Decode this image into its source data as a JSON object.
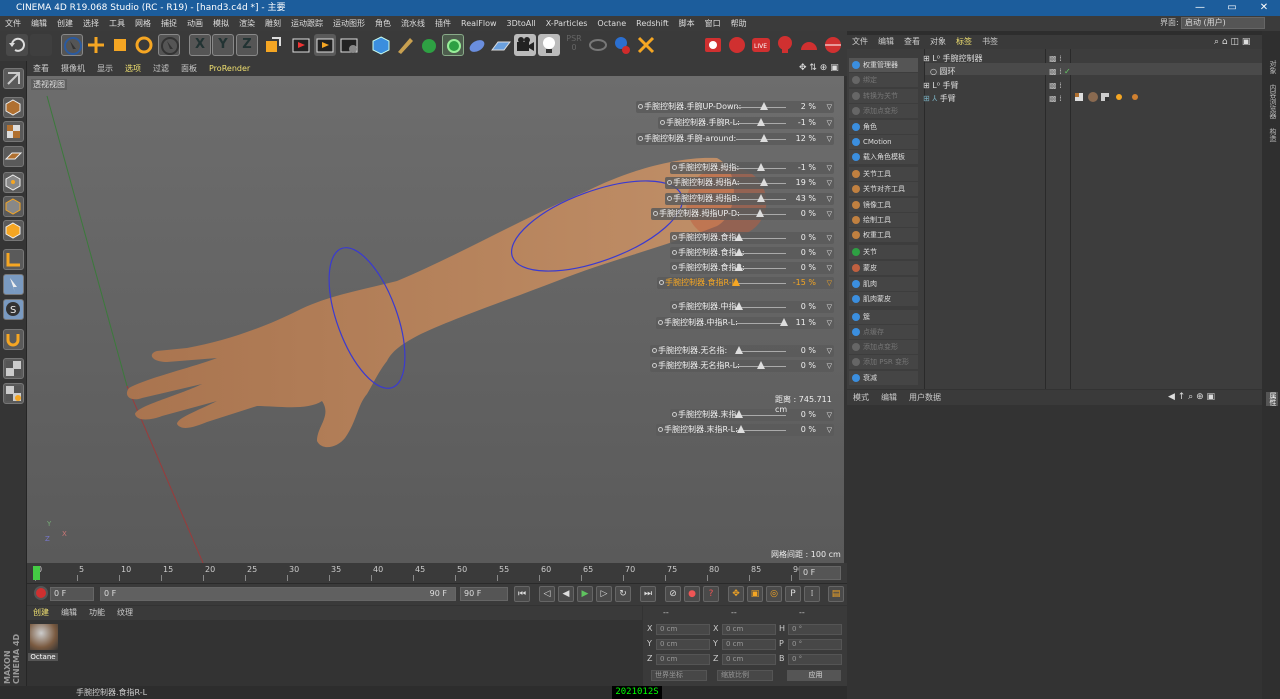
{
  "title": "CINEMA 4D R19.068 Studio (RC - R19) - [hand3.c4d *] - 主要",
  "menu": [
    "文件",
    "编辑",
    "创建",
    "选择",
    "工具",
    "网格",
    "捕捉",
    "动画",
    "模拟",
    "渲染",
    "雕刻",
    "运动跟踪",
    "运动图形",
    "角色",
    "流水线",
    "插件",
    "RealFlow",
    "3DtoAll",
    "X-Particles",
    "Octane",
    "Redshift",
    "脚本",
    "窗口",
    "帮助"
  ],
  "layout_label": "界面:",
  "layout_value": "启动 (用户)",
  "viewport": {
    "menu": [
      "查看",
      "摄像机",
      "显示",
      "选项",
      "过滤",
      "面板",
      "ProRender"
    ],
    "label": "透视视图",
    "distance": "距离 : 745.711 cm",
    "grid": "网格间距 : 100 cm"
  },
  "sliders": [
    {
      "label": "手腕控制器.手腕UP-Down:",
      "value": "2 %",
      "pos": 0.55
    },
    {
      "label": "手腕控制器.手腕R-L:",
      "value": "-1 %",
      "pos": 0.5
    },
    {
      "label": "手腕控制器.手腕-around:",
      "value": "12 %",
      "pos": 0.55
    },
    {
      "label": "手腕控制器.拇指:",
      "value": "-1 %",
      "pos": 0.5
    },
    {
      "label": "手腕控制器.拇指A:",
      "value": "19 %",
      "pos": 0.55
    },
    {
      "label": "手腕控制器.拇指B:",
      "value": "43 %",
      "pos": 0.5
    },
    {
      "label": "手腕控制器.拇指UP-D:",
      "value": "0 %",
      "pos": 0.48
    },
    {
      "label": "手腕控制器.食指:",
      "value": "0 %",
      "pos": 0.05
    },
    {
      "label": "手腕控制器.食指A:",
      "value": "0 %",
      "pos": 0.05
    },
    {
      "label": "手腕控制器.食指B:",
      "value": "0 %",
      "pos": 0.05
    },
    {
      "label": "手腕控制器.食指R-L:",
      "value": "-15 %",
      "pos": 0.0
    },
    {
      "label": "手腕控制器.中指:",
      "value": "0 %",
      "pos": 0.05
    },
    {
      "label": "手腕控制器.中指R-L:",
      "value": "11 %",
      "pos": 0.95
    },
    {
      "label": "手腕控制器.无名指:",
      "value": "0 %",
      "pos": 0.05
    },
    {
      "label": "手腕控制器.无名指R-L:",
      "value": "0 %",
      "pos": 0.5
    },
    {
      "label": "手腕控制器.末指:",
      "value": "0 %",
      "pos": 0.05
    },
    {
      "label": "手腕控制器.末指R-L:",
      "value": "0 %",
      "pos": 0.1
    }
  ],
  "timeline": {
    "ticks": [
      "0",
      "5",
      "10",
      "15",
      "20",
      "25",
      "30",
      "35",
      "40",
      "45",
      "50",
      "55",
      "60",
      "65",
      "70",
      "75",
      "80",
      "85",
      "90"
    ],
    "current": "0 F"
  },
  "transport": {
    "start": "0 F",
    "slider_left": "0 F",
    "slider_right": "90 F",
    "end": "90 F"
  },
  "material": {
    "menu": [
      "创建",
      "编辑",
      "功能",
      "纹理"
    ],
    "name": "Octane"
  },
  "coords": {
    "header": [
      "--",
      "--",
      "--"
    ],
    "rows": [
      [
        "X",
        "0 cm",
        "X",
        "0 cm",
        "H",
        "0 °"
      ],
      [
        "Y",
        "0 cm",
        "Y",
        "0 cm",
        "P",
        "0 °"
      ],
      [
        "Z",
        "0 cm",
        "Z",
        "0 cm",
        "B",
        "0 °"
      ]
    ],
    "mode1": "世界坐标",
    "mode2": "缩放比例",
    "apply": "应用"
  },
  "status": "手腕控制器.食指R-L",
  "watermark": "2021012S",
  "objects": {
    "menu": [
      "文件",
      "编辑",
      "查看",
      "对象",
      "标签",
      "书签"
    ],
    "commands": [
      "权重管理器",
      "绑定",
      "转换为关节",
      "添加点变形",
      "角色",
      "CMotion",
      "载入角色模板",
      "关节工具",
      "关节对齐工具",
      "镜像工具",
      "绘制工具",
      "权重工具",
      "关节",
      "蒙皮",
      "肌肉",
      "肌肉蒙皮",
      "簇",
      "点缓存",
      "添加点变形",
      "添加 PSR 变形",
      "衰减"
    ],
    "tree": [
      "手腕控制器",
      "圆环",
      "手臂",
      "手臂"
    ]
  },
  "attributes": {
    "menu": [
      "模式",
      "编辑",
      "用户数据"
    ]
  },
  "right_tabs": [
    "对象",
    "内容浏览器",
    "构造"
  ],
  "attr_tab": "属性",
  "logo": "MAXON CINEMA 4D"
}
